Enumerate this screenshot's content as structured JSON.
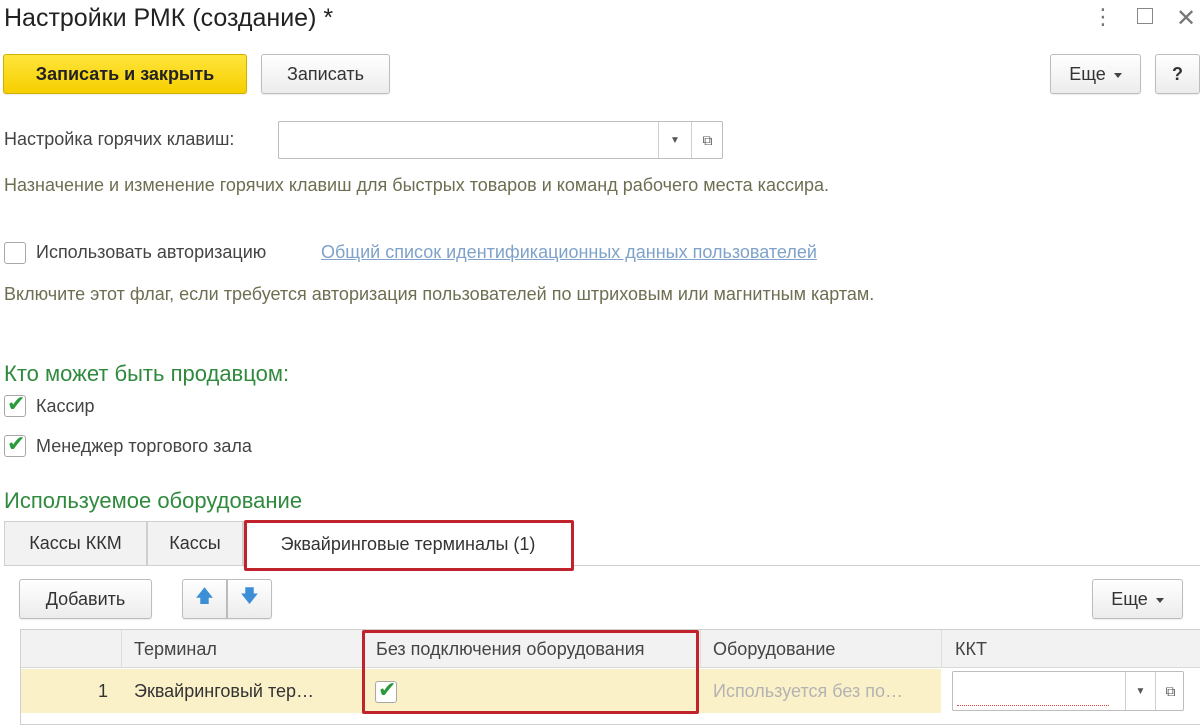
{
  "window": {
    "title": "Настройки РМК (создание) *",
    "more_icon": "more-vertical-icon",
    "maximize_icon": "maximize-icon",
    "close_icon": "close-icon"
  },
  "toolbar": {
    "save_close_label": "Записать и закрыть",
    "save_label": "Записать",
    "more_label": "Еще",
    "help_label": "?"
  },
  "hotkeys": {
    "label": "Настройка горячих клавиш:",
    "value": "",
    "hint": "Назначение и изменение горячих клавиш для быстрых товаров и команд рабочего места кассира."
  },
  "auth": {
    "checkbox_label": "Использовать авторизацию",
    "checked": false,
    "link_label": "Общий список идентификационных данных пользователей",
    "hint": "Включите этот флаг, если требуется авторизация пользователей по штриховым или магнитным картам."
  },
  "seller": {
    "heading": "Кто может быть продавцом:",
    "options": [
      {
        "label": "Кассир",
        "checked": true
      },
      {
        "label": "Менеджер торгового зала",
        "checked": true
      }
    ]
  },
  "equipment": {
    "heading": "Используемое оборудование",
    "tabs": [
      {
        "label": "Кассы ККМ",
        "active": false
      },
      {
        "label": "Кассы",
        "active": false
      },
      {
        "label": "Эквайринговые терминалы (1)",
        "active": true
      }
    ],
    "add_label": "Добавить",
    "more_label": "Еще",
    "up_icon": "arrow-up-icon",
    "down_icon": "arrow-down-icon",
    "table": {
      "columns": [
        "Терминал",
        "Без подключения оборудования",
        "Оборудование",
        "ККТ"
      ],
      "rows": [
        {
          "num": "1",
          "terminal": "Эквайринговый тер…",
          "no_connection": true,
          "equipment": "Используется без по…",
          "kkt": ""
        }
      ]
    }
  },
  "colors": {
    "primary_button": "#f6cf00",
    "heading_green": "#2f8a3d",
    "highlight_red": "#c0232b",
    "row_selected": "#fbf1c9",
    "link": "#7ea2c9"
  }
}
